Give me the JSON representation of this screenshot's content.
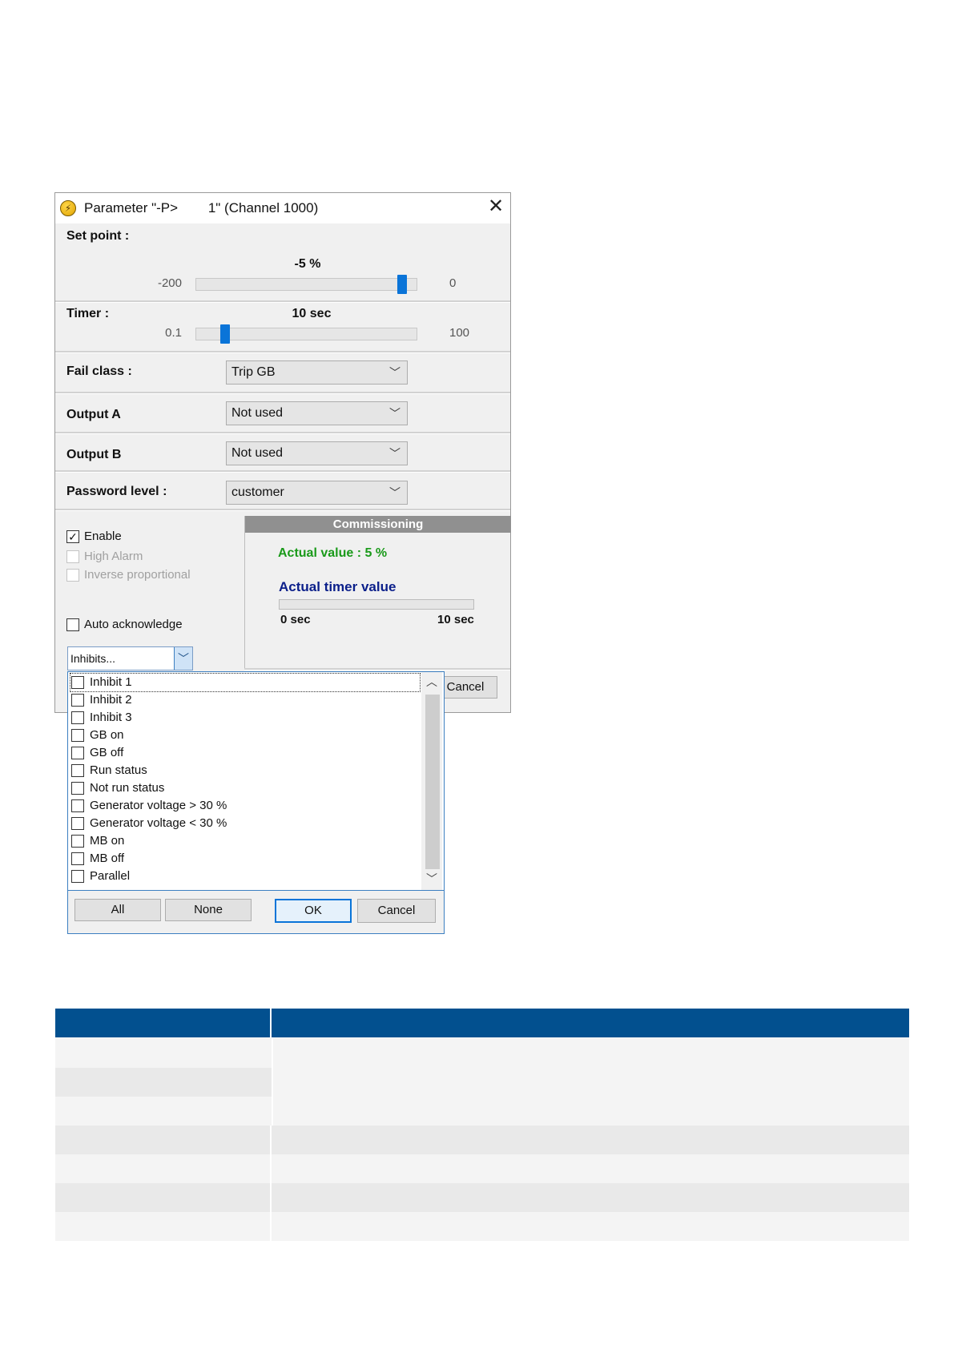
{
  "dialog": {
    "title": "Parameter \"-P>        1\" (Channel 1000)",
    "set_point": {
      "label": "Set point :",
      "value_text": "-5 %",
      "min": "-200",
      "max": "0",
      "level_fraction": 0.975
    },
    "timer": {
      "label": "Timer :",
      "value_text": "10 sec",
      "min": "0.1",
      "max": "100",
      "level_fraction": 0.1
    },
    "fail_class": {
      "label": "Fail class :",
      "selected": "Trip GB"
    },
    "output_a": {
      "label": "Output A",
      "selected": "Not used"
    },
    "output_b": {
      "label": "Output B",
      "selected": "Not used"
    },
    "password_level": {
      "label": "Password level :",
      "selected": "customer"
    },
    "checkboxes": {
      "enable": {
        "label": "Enable",
        "checked": true
      },
      "high_alarm": {
        "label": "High Alarm",
        "checked": false
      },
      "inverse_proportional": {
        "label": "Inverse proportional",
        "checked": false
      },
      "auto_acknowledge": {
        "label": "Auto acknowledge",
        "checked": false
      }
    },
    "commissioning": {
      "header": "Commissioning",
      "actual_value": "Actual value : 5 %",
      "actual_timer_label": "Actual timer value",
      "timer_min": "0 sec",
      "timer_max": "10 sec",
      "actual_value_color": "#1a9a1a",
      "actual_timer_color": "#0b1f8a"
    },
    "cancel_label": "Cancel"
  },
  "inhibits": {
    "combo_text": "Inhibits...",
    "items": [
      "Inhibit 1",
      "Inhibit 2",
      "Inhibit 3",
      "GB on",
      "GB off",
      "Run status",
      "Not run status",
      "Generator voltage > 30 %",
      "Generator voltage < 30 %",
      "MB on",
      "MB off",
      "Parallel"
    ],
    "buttons": {
      "all": "All",
      "none": "None",
      "ok": "OK",
      "cancel": "Cancel"
    }
  },
  "colors": {
    "table_header": "#02508f",
    "row_light": "#f4f4f4",
    "row_dark": "#e9e9e9",
    "accent": "#0a74d8"
  }
}
